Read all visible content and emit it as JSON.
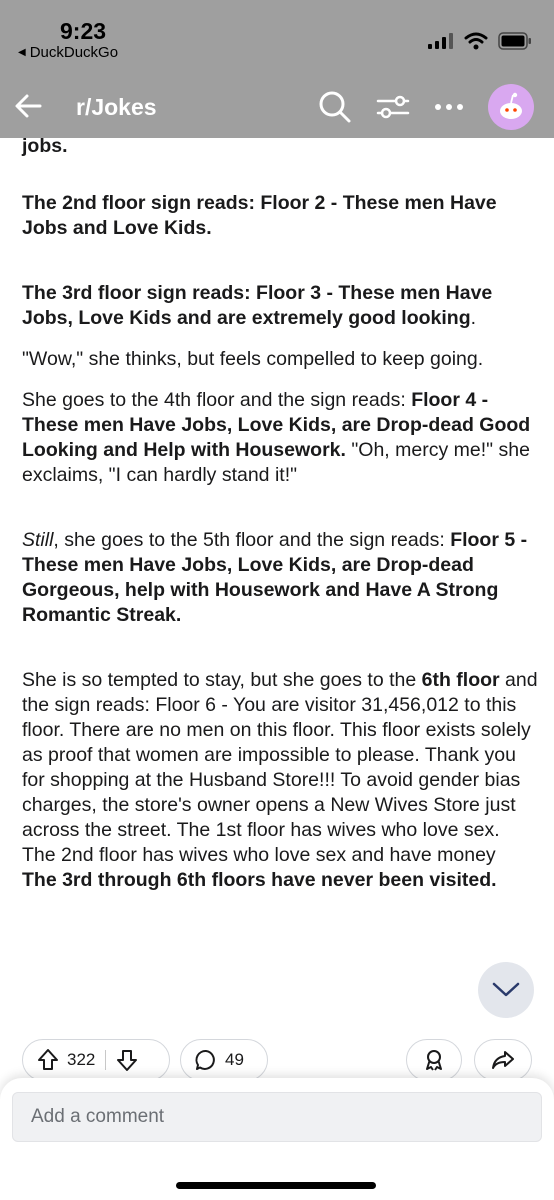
{
  "status_bar": {
    "time": "9:23",
    "back_app": "DuckDuckGo"
  },
  "nav": {
    "title": "r/Jokes"
  },
  "post": {
    "fragment_top": "jobs.",
    "p_floor2": "The 2nd floor sign reads: Floor 2 - These men Have Jobs and Love Kids.",
    "p_floor3": "The 3rd floor sign reads: Floor 3 - These men Have Jobs, Love Kids and are extremely good looking",
    "p_floor3_end": ".",
    "p_wow": "\"Wow,\" she thinks, but feels compelled to keep going.",
    "p4_a": "She goes to the 4th floor and the sign reads: ",
    "p4_b": "Floor 4 - These men Have Jobs, Love Kids, are Drop-dead Good Looking and Help with Housework.",
    "p4_c": " \"Oh, mercy me!\" she exclaims, \"I can hardly stand it!\"",
    "p5_a": "Still",
    "p5_b": ", she goes to the 5th floor and the sign reads: ",
    "p5_c": "Floor 5 - These men Have Jobs, Love Kids, are Drop-dead Gorgeous, help with Housework and Have A Strong Romantic Streak.",
    "p6_a": "She is so tempted to stay, but she goes to the ",
    "p6_b": "6th floor",
    "p6_c": " and the sign reads: Floor 6 - You are visitor 31,456,012 to this floor. There are no men on this floor. This floor exists solely as proof that women are impossible to please. Thank you for shopping at the Husband Store!!! To avoid gender bias charges, the store's owner opens a New Wives Store just across the street. The 1st floor has wives who love sex. The 2nd floor has wives who love sex and have money",
    "p6_d": "The 3rd through 6th floors have never been visited."
  },
  "actions": {
    "upvotes": "322",
    "comments": "49"
  },
  "composer": {
    "placeholder": "Add a comment"
  },
  "colors": {
    "header_bg": "#9f9f9f",
    "avatar_bg": "#d9a8f0"
  }
}
